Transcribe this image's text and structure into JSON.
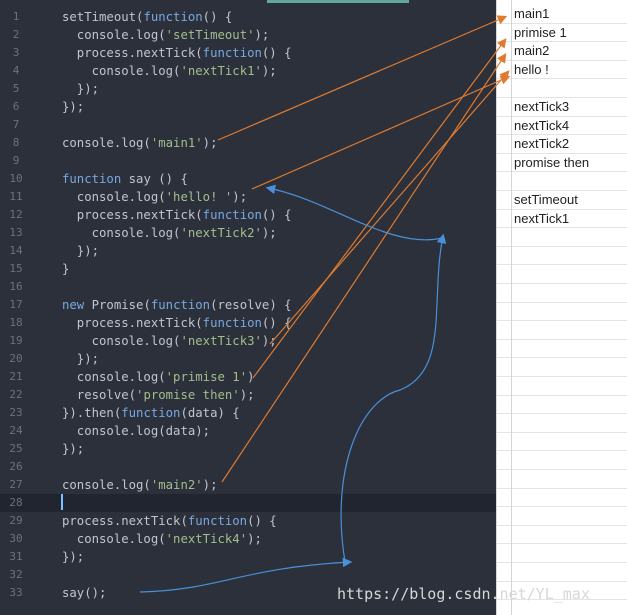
{
  "editor": {
    "lines": [
      {
        "n": "1",
        "text": "setTimeout(function() {"
      },
      {
        "n": "2",
        "text": "  console.log('setTimeout');"
      },
      {
        "n": "3",
        "text": "  process.nextTick(function() {"
      },
      {
        "n": "4",
        "text": "    console.log('nextTick1');"
      },
      {
        "n": "5",
        "text": "  });"
      },
      {
        "n": "6",
        "text": "});"
      },
      {
        "n": "7",
        "text": ""
      },
      {
        "n": "8",
        "text": "console.log('main1');"
      },
      {
        "n": "9",
        "text": ""
      },
      {
        "n": "10",
        "text": "function say () {"
      },
      {
        "n": "11",
        "text": "  console.log('hello! ');"
      },
      {
        "n": "12",
        "text": "  process.nextTick(function() {"
      },
      {
        "n": "13",
        "text": "    console.log('nextTick2');"
      },
      {
        "n": "14",
        "text": "  });"
      },
      {
        "n": "15",
        "text": "}"
      },
      {
        "n": "16",
        "text": ""
      },
      {
        "n": "17",
        "text": "new Promise(function(resolve) {"
      },
      {
        "n": "18",
        "text": "  process.nextTick(function() {"
      },
      {
        "n": "19",
        "text": "    console.log('nextTick3');"
      },
      {
        "n": "20",
        "text": "  });"
      },
      {
        "n": "21",
        "text": "  console.log('primise 1')"
      },
      {
        "n": "22",
        "text": "  resolve('promise then');"
      },
      {
        "n": "23",
        "text": "}).then(function(data) {"
      },
      {
        "n": "24",
        "text": "  console.log(data);"
      },
      {
        "n": "25",
        "text": "});"
      },
      {
        "n": "26",
        "text": ""
      },
      {
        "n": "27",
        "text": "console.log('main2');"
      },
      {
        "n": "28",
        "text": ""
      },
      {
        "n": "29",
        "text": "process.nextTick(function() {"
      },
      {
        "n": "30",
        "text": "  console.log('nextTick4');"
      },
      {
        "n": "31",
        "text": "});"
      },
      {
        "n": "32",
        "text": ""
      },
      {
        "n": "33",
        "text": "say();"
      }
    ]
  },
  "output": {
    "rows": [
      "main1",
      "primise 1",
      "main2",
      "hello !",
      "",
      "nextTick3",
      "nextTick4",
      "nextTick2",
      "promise then",
      "",
      "setTimeout",
      "nextTick1"
    ]
  },
  "watermark": "https://blog.csdn.net/YL_max",
  "colors": {
    "editor_bg": "#2b303b",
    "orange_arrow": "#e07a2e",
    "blue_arrow": "#4a90d9"
  }
}
